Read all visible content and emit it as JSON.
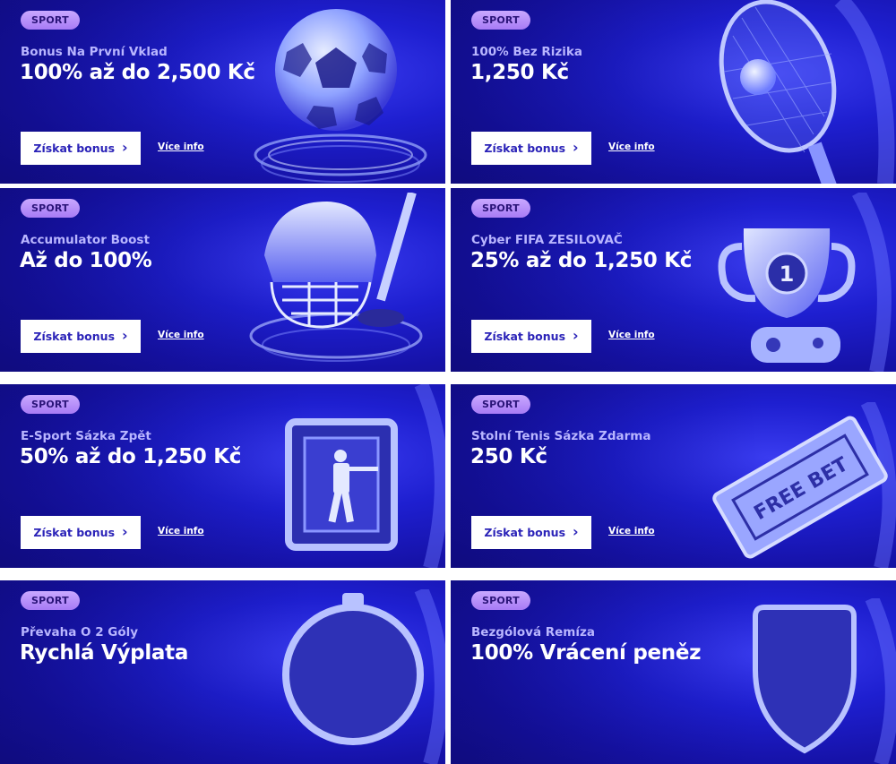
{
  "cards": [
    {
      "badge": "SPORT",
      "subtitle": "Bonus Na První Vklad",
      "amount": "100% až do 2,500 Kč",
      "button": "Získat bonus",
      "more": "Více info",
      "art_icon": "soccer-ball-icon"
    },
    {
      "badge": "SPORT",
      "subtitle": "100% Bez Rizika",
      "amount": "1,250 Kč",
      "button": "Získat bonus",
      "more": "Více info",
      "art_icon": "tennis-racket-icon"
    },
    {
      "badge": "SPORT",
      "subtitle": "Accumulator Boost",
      "amount": "Až do 100%",
      "button": "Získat bonus",
      "more": "Více info",
      "art_icon": "hockey-helmet-icon"
    },
    {
      "badge": "SPORT",
      "subtitle": "Cyber FIFA ZESILOVAČ",
      "amount": "25% až do 1,250 Kč",
      "button": "Získat bonus",
      "more": "Více info",
      "art_icon": "trophy-gamepad-icon",
      "art_text": "1"
    },
    {
      "badge": "SPORT",
      "subtitle": "E-Sport Sázka Zpět",
      "amount": "50% až do 1,250 Kč",
      "button": "Získat bonus",
      "more": "Více info",
      "art_icon": "esport-soldier-icon"
    },
    {
      "badge": "SPORT",
      "subtitle": "Stolní Tenis Sázka Zdarma",
      "amount": "250 Kč",
      "button": "Získat bonus",
      "more": "Více info",
      "art_icon": "free-bet-ticket-icon",
      "art_text": "FREE BET"
    },
    {
      "badge": "SPORT",
      "subtitle": "Převaha O 2 Góly",
      "amount": "Rychlá Výplata",
      "art_icon": "stopwatch-icon"
    },
    {
      "badge": "SPORT",
      "subtitle": "Bezgólová Remíza",
      "amount": "100% Vrácení peněz",
      "art_icon": "shield-icon"
    }
  ],
  "colors": {
    "card_bg": "#1e1fd0",
    "badge_bg": "#b28cf7",
    "subtitle": "#b9b6ff",
    "button_text": "#2b23b8"
  }
}
